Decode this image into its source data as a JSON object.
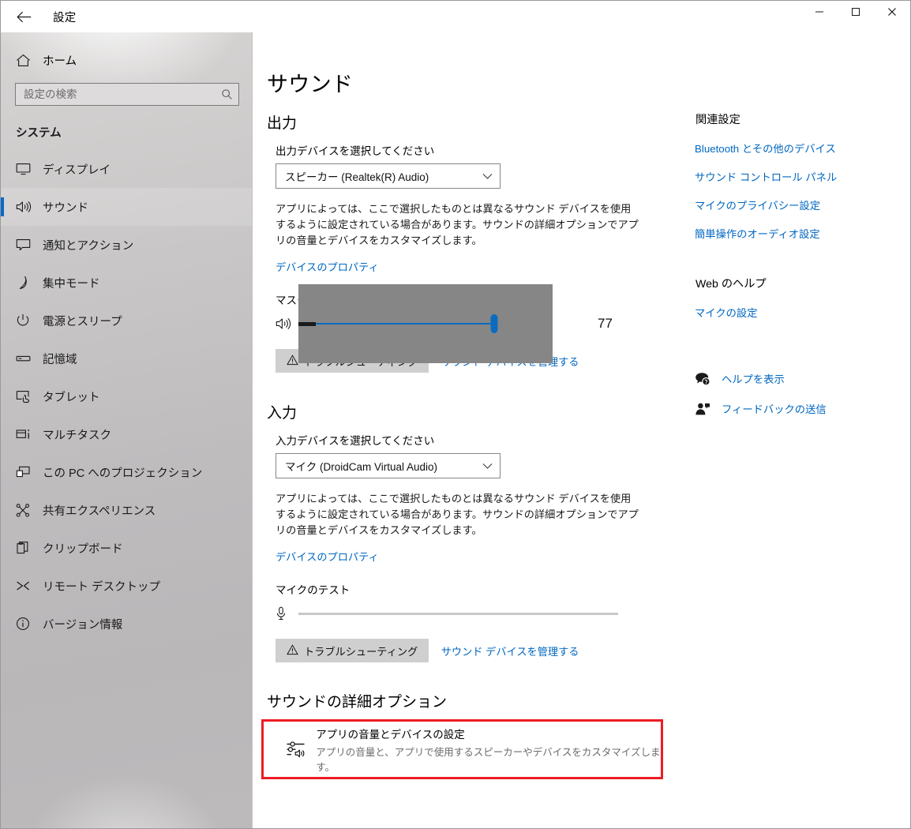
{
  "window": {
    "title": "設定",
    "back_icon": "back-arrow-icon",
    "minimize_label": "─",
    "maximize_label": "□",
    "close_label": "✕"
  },
  "sidebar": {
    "home_label": "ホーム",
    "home_icon": "home-icon",
    "search": {
      "placeholder": "設定の検索",
      "value": "",
      "icon": "search-icon"
    },
    "section_title": "システム",
    "accent_color": "#0a69c7",
    "items": [
      {
        "label": "ディスプレイ",
        "icon": "display-icon",
        "selected": false
      },
      {
        "label": "サウンド",
        "icon": "speaker-icon",
        "selected": true
      },
      {
        "label": "通知とアクション",
        "icon": "notification-icon",
        "selected": false
      },
      {
        "label": "集中モード",
        "icon": "moon-icon",
        "selected": false
      },
      {
        "label": "電源とスリープ",
        "icon": "power-icon",
        "selected": false
      },
      {
        "label": "記憶域",
        "icon": "storage-icon",
        "selected": false
      },
      {
        "label": "タブレット",
        "icon": "tablet-icon",
        "selected": false
      },
      {
        "label": "マルチタスク",
        "icon": "multitask-icon",
        "selected": false
      },
      {
        "label": "この PC へのプロジェクション",
        "icon": "projection-icon",
        "selected": false
      },
      {
        "label": "共有エクスペリエンス",
        "icon": "share-icon",
        "selected": false
      },
      {
        "label": "クリップボード",
        "icon": "clipboard-icon",
        "selected": false
      },
      {
        "label": "リモート デスクトップ",
        "icon": "remote-desktop-icon",
        "selected": false
      },
      {
        "label": "バージョン情報",
        "icon": "info-icon",
        "selected": false
      }
    ]
  },
  "main": {
    "page_title": "サウンド",
    "output": {
      "heading": "出力",
      "device_label": "出力デバイスを選択してください",
      "device_value": "スピーカー (Realtek(R) Audio)",
      "description": "アプリによっては、ここで選択したものとは異なるサウンド デバイスを使用するように設定されている場合があります。サウンドの詳細オプションでアプリの音量とデバイスをカスタマイズします。",
      "properties_link": "デバイスのプロパティ",
      "volume_label": "マスター音量",
      "volume_value": "77",
      "volume_percent": 77,
      "troubleshoot_label": "トラブルシューティング",
      "manage_link": "サウンド デバイスを管理する"
    },
    "input": {
      "heading": "入力",
      "device_label": "入力デバイスを選択してください",
      "device_value": "マイク (DroidCam Virtual Audio)",
      "description": "アプリによっては、ここで選択したものとは異なるサウンド デバイスを使用するように設定されている場合があります。サウンドの詳細オプションでアプリの音量とデバイスをカスタマイズします。",
      "properties_link": "デバイスのプロパティ",
      "test_label": "マイクのテスト",
      "test_level_percent": 0,
      "troubleshoot_label": "トラブルシューティング",
      "manage_link": "サウンド デバイスを管理する"
    },
    "advanced": {
      "heading": "サウンドの詳細オプション",
      "highlight_color": "#ed1c24",
      "item_icon": "app-volume-mixer-icon",
      "item_title": "アプリの音量とデバイスの設定",
      "item_subtitle": "アプリの音量と、アプリで使用するスピーカーやデバイスをカスタマイズします。"
    }
  },
  "rail": {
    "related_heading": "関連設定",
    "related_links": [
      "Bluetooth とその他のデバイス",
      "サウンド コントロール パネル",
      "マイクのプライバシー設定",
      "簡単操作のオーディオ設定"
    ],
    "web_help_heading": "Web のヘルプ",
    "web_help_links": [
      "マイクの設定"
    ],
    "support_items": [
      {
        "label": "ヘルプを表示",
        "icon": "help-bubble-icon"
      },
      {
        "label": "フィードバックの送信",
        "icon": "feedback-person-icon"
      }
    ]
  }
}
